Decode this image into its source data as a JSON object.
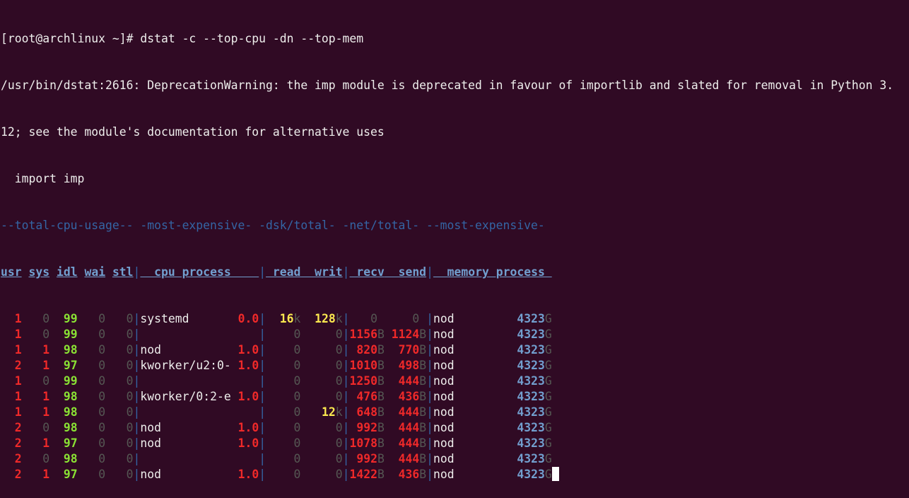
{
  "prompt": "[root@archlinux ~]# dstat -c --top-cpu -dn --top-mem",
  "warning_lines": [
    "/usr/bin/dstat:2616: DeprecationWarning: the imp module is deprecated in favour of importlib and slated for removal in Python 3.",
    "12; see the module's documentation for alternative uses",
    "  import imp"
  ],
  "group_header": "--total-cpu-usage-- -most-expensive- -dsk/total- -net/total- --most-expensive-",
  "column_headers": {
    "cpu": [
      "usr",
      "sys",
      "idl",
      "wai",
      "stl"
    ],
    "cpu_process": "  cpu process    ",
    "dsk": [
      " read",
      "  writ"
    ],
    "net": [
      " recv",
      "  send"
    ],
    "mem_process": "  memory process "
  },
  "rows": [
    {
      "usr": "1",
      "sys": "0",
      "idl": "99",
      "wai": "0",
      "stl": "0",
      "proc": "systemd",
      "pct": "0.0",
      "read": "16",
      "read_u": "k",
      "writ": "128",
      "writ_u": "k",
      "recv": "0",
      "recv_u": "",
      "send": "0",
      "send_u": "",
      "mem_proc": "nod",
      "mem": "4323",
      "mem_u": "G"
    },
    {
      "usr": "1",
      "sys": "0",
      "idl": "99",
      "wai": "0",
      "stl": "0",
      "proc": "",
      "pct": "",
      "read": "0",
      "read_u": "",
      "writ": "0",
      "writ_u": "",
      "recv": "1156",
      "recv_u": "B",
      "send": "1124",
      "send_u": "B",
      "mem_proc": "nod",
      "mem": "4323",
      "mem_u": "G"
    },
    {
      "usr": "1",
      "sys": "1",
      "idl": "98",
      "wai": "0",
      "stl": "0",
      "proc": "nod",
      "pct": "1.0",
      "read": "0",
      "read_u": "",
      "writ": "0",
      "writ_u": "",
      "recv": "820",
      "recv_u": "B",
      "send": "770",
      "send_u": "B",
      "mem_proc": "nod",
      "mem": "4323",
      "mem_u": "G"
    },
    {
      "usr": "2",
      "sys": "1",
      "idl": "97",
      "wai": "0",
      "stl": "0",
      "proc": "kworker/u2:0-",
      "pct": "1.0",
      "read": "0",
      "read_u": "",
      "writ": "0",
      "writ_u": "",
      "recv": "1010",
      "recv_u": "B",
      "send": "498",
      "send_u": "B",
      "mem_proc": "nod",
      "mem": "4323",
      "mem_u": "G"
    },
    {
      "usr": "1",
      "sys": "0",
      "idl": "99",
      "wai": "0",
      "stl": "0",
      "proc": "",
      "pct": "",
      "read": "0",
      "read_u": "",
      "writ": "0",
      "writ_u": "",
      "recv": "1250",
      "recv_u": "B",
      "send": "444",
      "send_u": "B",
      "mem_proc": "nod",
      "mem": "4323",
      "mem_u": "G"
    },
    {
      "usr": "1",
      "sys": "1",
      "idl": "98",
      "wai": "0",
      "stl": "0",
      "proc": "kworker/0:2-e",
      "pct": "1.0",
      "read": "0",
      "read_u": "",
      "writ": "0",
      "writ_u": "",
      "recv": "476",
      "recv_u": "B",
      "send": "436",
      "send_u": "B",
      "mem_proc": "nod",
      "mem": "4323",
      "mem_u": "G"
    },
    {
      "usr": "1",
      "sys": "1",
      "idl": "98",
      "wai": "0",
      "stl": "0",
      "proc": "",
      "pct": "",
      "read": "0",
      "read_u": "",
      "writ": "12",
      "writ_u": "k",
      "recv": "648",
      "recv_u": "B",
      "send": "444",
      "send_u": "B",
      "mem_proc": "nod",
      "mem": "4323",
      "mem_u": "G"
    },
    {
      "usr": "2",
      "sys": "0",
      "idl": "98",
      "wai": "0",
      "stl": "0",
      "proc": "nod",
      "pct": "1.0",
      "read": "0",
      "read_u": "",
      "writ": "0",
      "writ_u": "",
      "recv": "992",
      "recv_u": "B",
      "send": "444",
      "send_u": "B",
      "mem_proc": "nod",
      "mem": "4323",
      "mem_u": "G"
    },
    {
      "usr": "2",
      "sys": "1",
      "idl": "97",
      "wai": "0",
      "stl": "0",
      "proc": "nod",
      "pct": "1.0",
      "read": "0",
      "read_u": "",
      "writ": "0",
      "writ_u": "",
      "recv": "1078",
      "recv_u": "B",
      "send": "444",
      "send_u": "B",
      "mem_proc": "nod",
      "mem": "4323",
      "mem_u": "G"
    },
    {
      "usr": "2",
      "sys": "0",
      "idl": "98",
      "wai": "0",
      "stl": "0",
      "proc": "",
      "pct": "",
      "read": "0",
      "read_u": "",
      "writ": "0",
      "writ_u": "",
      "recv": "992",
      "recv_u": "B",
      "send": "444",
      "send_u": "B",
      "mem_proc": "nod",
      "mem": "4323",
      "mem_u": "G"
    },
    {
      "usr": "2",
      "sys": "1",
      "idl": "97",
      "wai": "0",
      "stl": "0",
      "proc": "nod",
      "pct": "1.0",
      "read": "0",
      "read_u": "",
      "writ": "0",
      "writ_u": "",
      "recv": "1422",
      "recv_u": "B",
      "send": "436",
      "send_u": "B",
      "mem_proc": "nod",
      "mem": "4323",
      "mem_u": "G"
    }
  ]
}
